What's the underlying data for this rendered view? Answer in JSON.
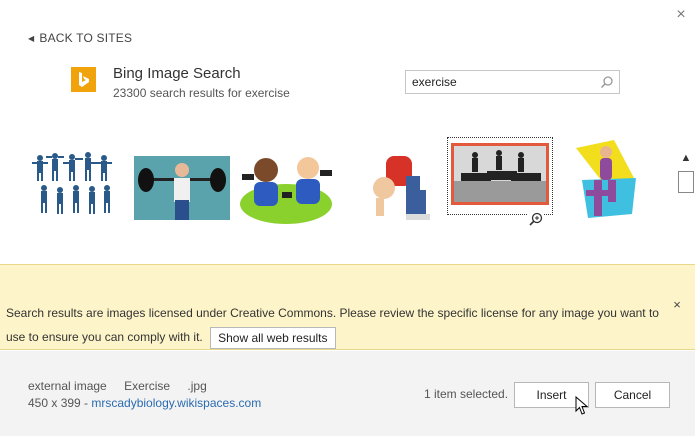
{
  "dialog": {
    "close_glyph": "×",
    "back_label": "BACK TO SITES"
  },
  "provider": {
    "name": "Bing Image Search",
    "result_count_text": "23300 search results for exercise",
    "logo_icon": "bing-logo-icon",
    "brand_color": "#f0a30a"
  },
  "search": {
    "value": "exercise",
    "placeholder": ""
  },
  "results": {
    "selected_index": 5,
    "accent_color": "#e25a3b",
    "row1": [
      {
        "id": "silhouettes"
      },
      {
        "id": "weightlifter"
      },
      {
        "id": "cartoon-dumbbells"
      },
      {
        "id": "child-stretching"
      },
      {
        "id": "treadmill-runners"
      },
      {
        "id": "woman-exercising-clipart"
      }
    ],
    "row2_partial_count": 6
  },
  "notice": {
    "text": "Search results are images licensed under Creative Commons. Please review the specific license for any image you want to use to ensure you can comply with it.",
    "show_all_label": "Show all web results",
    "close_glyph": "×",
    "background_color": "#fdf5c9"
  },
  "details": {
    "type_label": "external image",
    "title": "Exercise",
    "extension": ".jpg",
    "dimensions": "450 x 399 - ",
    "source_link": "mrscadybiology.wikispaces.com",
    "selection_status": "1 item selected."
  },
  "buttons": {
    "insert_label": "Insert",
    "cancel_label": "Cancel"
  }
}
